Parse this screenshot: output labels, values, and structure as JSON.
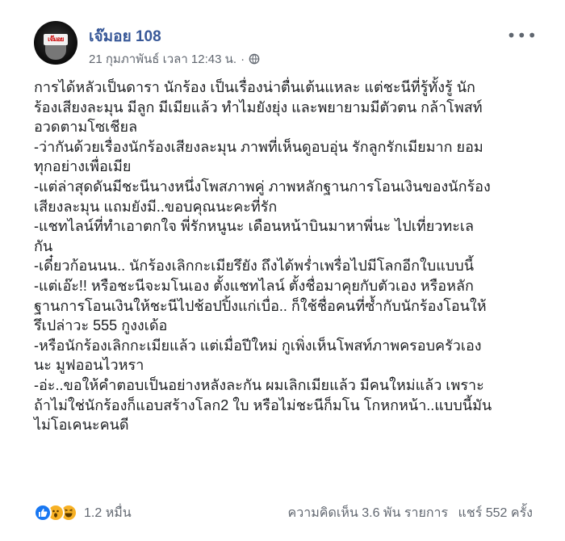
{
  "post": {
    "author": "เจ๊มอย 108",
    "date": "21 กุมภาพันธ์ เวลา 12:43 น.",
    "dot": "·",
    "avatar_label": "เจ๊มอย",
    "lines": [
      "การได้หลัวเป็นดารา นักร้อง เป็นเรื่องน่าตื่นเต้นแหละ แต่ชะนีที่รู้ทั้งรู้ นัก",
      "ร้องเสียงละมุน มีลูก มีเมียแล้ว ทำไมยังยุ่ง และพยายามมีตัวตน กล้าโพสท์",
      "อวดตามโซเชียล",
      "-ว่ากันด้วยเรื่องนักร้องเสียงละมุน ภาพที่เห็นดูอบอุ่น รักลูกรักเมียมาก ยอม",
      "ทุกอย่างเพื่อเมีย",
      "-แต่ล่าสุดดันมีชะนีนางหนึ่งโพสภาพคู่ ภาพหลักฐานการโอนเงินของนักร้อง",
      "เสียงละมุน แถมยังมี..ขอบคุณนะคะที่รัก",
      "-แชทไลน์ที่ทำเอาตกใจ พี่รักหนูนะ เดือนหน้าบินมาหาพี่นะ ไปเที่ยวทะเล",
      "กัน",
      "-เดี๋ยวก้อนนน.. นักร้องเลิกกะเมียรึยัง ถึงได้พร่ำเพรื่อไปมีโลกอีกใบแบบนี้",
      "-แต่เอ๊ะ!! หรือชะนีจะมโนเอง ตั้งแชทไลน์ ตั้งชื่อมาคุยกับตัวเอง หรือหลัก",
      "ฐานการโอนเงินให้ชะนีไปช้อปปิ้งแก่เบื่อ.. ก็ใช้ชื่อคนที่ซ้ำกับนักร้องโอนให้",
      "รึเปล่าวะ 555 กูงงเด้อ",
      "-หรือนักร้องเลิกกะเมียแล้ว แต่เมื่อปีใหม่ กูเพิ่งเห็นโพสท์ภาพครอบครัวเอง",
      "นะ มูฟออนไวหรา",
      "-อ่ะ..ขอให้คำตอบเป็นอย่างหลังละกัน ผมเลิกเมียแล้ว มีคนใหม่แล้ว เพราะ",
      "ถ้าไม่ใช่นักร้องก็แอบสร้างโลก2 ใบ หรือไม่ชะนีก็มโน โกหกหน้า..แบบนี้มัน",
      "ไม่โอเคนะคนดี"
    ],
    "reaction_count": "1.2 หมื่น",
    "comments": "ความคิดเห็น 3.6 พัน รายการ",
    "shares": "แชร์ 552 ครั้ง",
    "icons": {
      "more": "more-options-icon",
      "globe": "globe-icon",
      "reactions": [
        "like-icon",
        "wow-icon",
        "haha-icon"
      ]
    },
    "colors": {
      "author": "#385898",
      "meta": "#616770",
      "like": "#1877f2",
      "emoji": "#f7b125"
    }
  }
}
